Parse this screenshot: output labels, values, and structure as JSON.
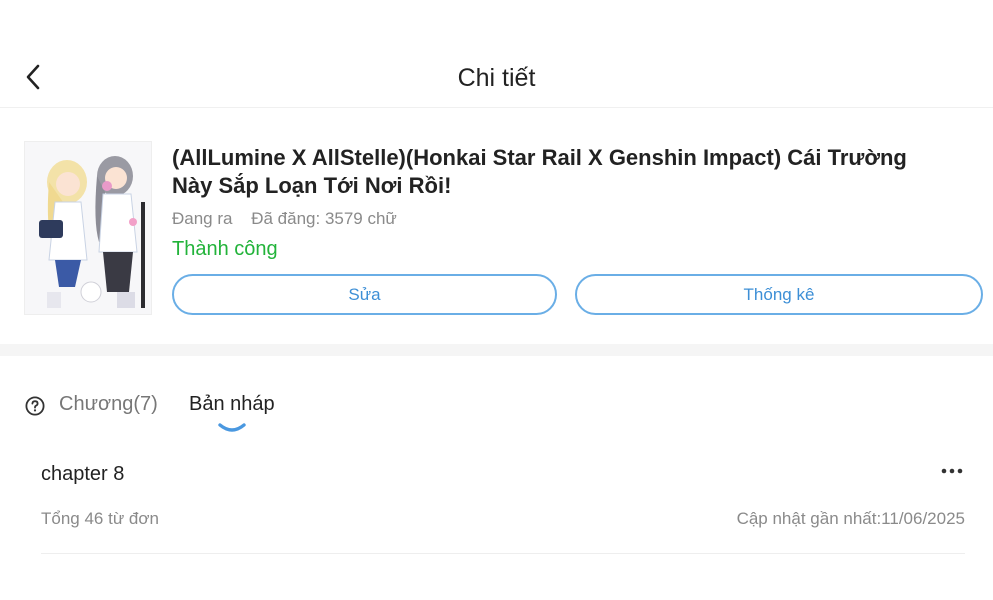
{
  "header": {
    "title": "Chi tiết"
  },
  "book": {
    "title": "(AllLumine X AllStelle)(Honkai Star Rail X Genshin Impact) Cái Trường Này Sắp Loạn Tới Nơi Rồi!",
    "status_label": "Đang ra",
    "word_count_label": "Đã đăng: 3579 chữ",
    "publish_status": "Thành công",
    "edit_label": "Sửa",
    "stats_label": "Thống kê"
  },
  "tabs": [
    {
      "label": "Chương(7)",
      "active": false
    },
    {
      "label": "Bản nháp",
      "active": true
    }
  ],
  "drafts": [
    {
      "title": "chapter 8",
      "words": "Tổng 46 từ đơn",
      "updated": "Cập nhật gần nhất:11/06/2025"
    }
  ],
  "colors": {
    "success": "#22b33a",
    "accent": "#3d8fd6",
    "button_border": "#6aaee6",
    "muted_text": "#8a8a8a"
  },
  "icons": [
    "back-arrow-icon",
    "question-circle-icon",
    "more-dots-icon"
  ]
}
